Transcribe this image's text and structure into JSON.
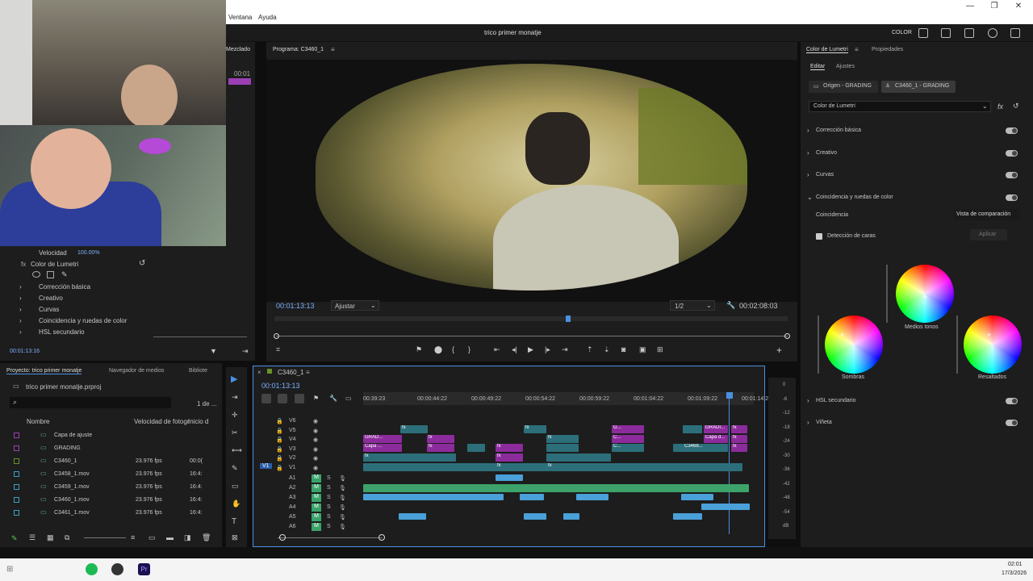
{
  "menu": {
    "items": [
      "Ventana",
      "Ayuda"
    ]
  },
  "app": {
    "title": "trico primer monatje",
    "workspace": "COLOR"
  },
  "effect_controls": {
    "panel_tab": "Mezclado",
    "tc_top": "00:01",
    "velocidad_label": "Velocidad",
    "velocidad_value": "100.00%",
    "lumetri_label": "Color de Lumetri",
    "sections": [
      "Corrección básica",
      "Creativo",
      "Curvas",
      "Coincidencia y ruedas de color",
      "HSL secundario"
    ],
    "timecode": "00:01:13:16"
  },
  "program": {
    "tab": "Programa: C3460_1",
    "timecode": "00:01:13:13",
    "fit": "Ajustar",
    "resolution": "1/2",
    "duration": "00:02:08:03"
  },
  "project": {
    "tabs": [
      "Proyecto: trico primer monatje",
      "Navegador de medios",
      "Bibliote"
    ],
    "file": "trico primer monatje.prproj",
    "count": "1 de ...",
    "columns": [
      "Nombre",
      "Velocidad de fotogr",
      "Inicio d"
    ],
    "items": [
      {
        "name": "Capa de ajuste",
        "fps": "",
        "start": "",
        "color": "#9b3fb5"
      },
      {
        "name": "GRADING",
        "fps": "",
        "start": "",
        "color": "#9b3fb5"
      },
      {
        "name": "C3460_1",
        "fps": "23.976 fps",
        "start": "00:0(",
        "color": "#6b8f2a"
      },
      {
        "name": "C3458_1.mov",
        "fps": "23.976 fps",
        "start": "16:4:",
        "color": "#3aa0c0"
      },
      {
        "name": "C3459_1.mov",
        "fps": "23.976 fps",
        "start": "16:4:",
        "color": "#3aa0c0"
      },
      {
        "name": "C3460_1.mov",
        "fps": "23.976 fps",
        "start": "16:4:",
        "color": "#3aa0c0"
      },
      {
        "name": "C3461_1.mov",
        "fps": "23.976 fps",
        "start": "16:4:",
        "color": "#3aa0c0"
      }
    ]
  },
  "timeline": {
    "tab": "C3460_1",
    "timecode": "00:01:13:13",
    "ruler": [
      "00:39:23",
      "00:00:44:22",
      "00:00:49:22",
      "00:00:54:22",
      "00:00:59:22",
      "00:01:04:22",
      "00:01:09:22",
      "00:01:14:2"
    ],
    "video_tracks": [
      "V6",
      "V5",
      "V4",
      "V3",
      "V2",
      "V1"
    ],
    "audio_tracks": [
      "A1",
      "A2",
      "A3",
      "A4",
      "A5",
      "A6"
    ],
    "source_v": "V1",
    "clip_labels": {
      "grad": "GRAD...",
      "capa": "Capa ...",
      "gradi": "GRADI...",
      "capa_d": "Capa d...",
      "c3468": "C3468...",
      "g": "G...",
      "c": "C...",
      "fx": "fx"
    },
    "meter": [
      "0",
      "-6",
      "-12",
      "-18",
      "-24",
      "-30",
      "-36",
      "-42",
      "-48",
      "-54",
      "dB"
    ],
    "mute": "M",
    "solo": "S"
  },
  "lumetri": {
    "tabs": [
      "Color de Lumetri",
      "Propiedades"
    ],
    "subtabs": [
      "Editar",
      "Ajustes"
    ],
    "source_btn": "Origen - GRADING",
    "target_btn": "C3460_1 - GRADING",
    "effect_select": "Color de Lumetri",
    "sections": [
      "Corrección básica",
      "Creativo",
      "Curvas",
      "Coincidencia y ruedas de color"
    ],
    "coincidencia_label": "Coincidencia",
    "comparison_btn": "Vista de comparación",
    "face_detect": "Detección de caras",
    "apply_btn": "Aplicar",
    "wheels": [
      "Medios tonos",
      "Sombras",
      "Resaltados"
    ],
    "bottom_sections": [
      "HSL secundario",
      "Viñeta"
    ]
  },
  "taskbar": {
    "time": "02:01",
    "date": "17/3/2026",
    "app_icons": [
      "spotify-icon",
      "obs-icon",
      "premiere-icon"
    ]
  }
}
